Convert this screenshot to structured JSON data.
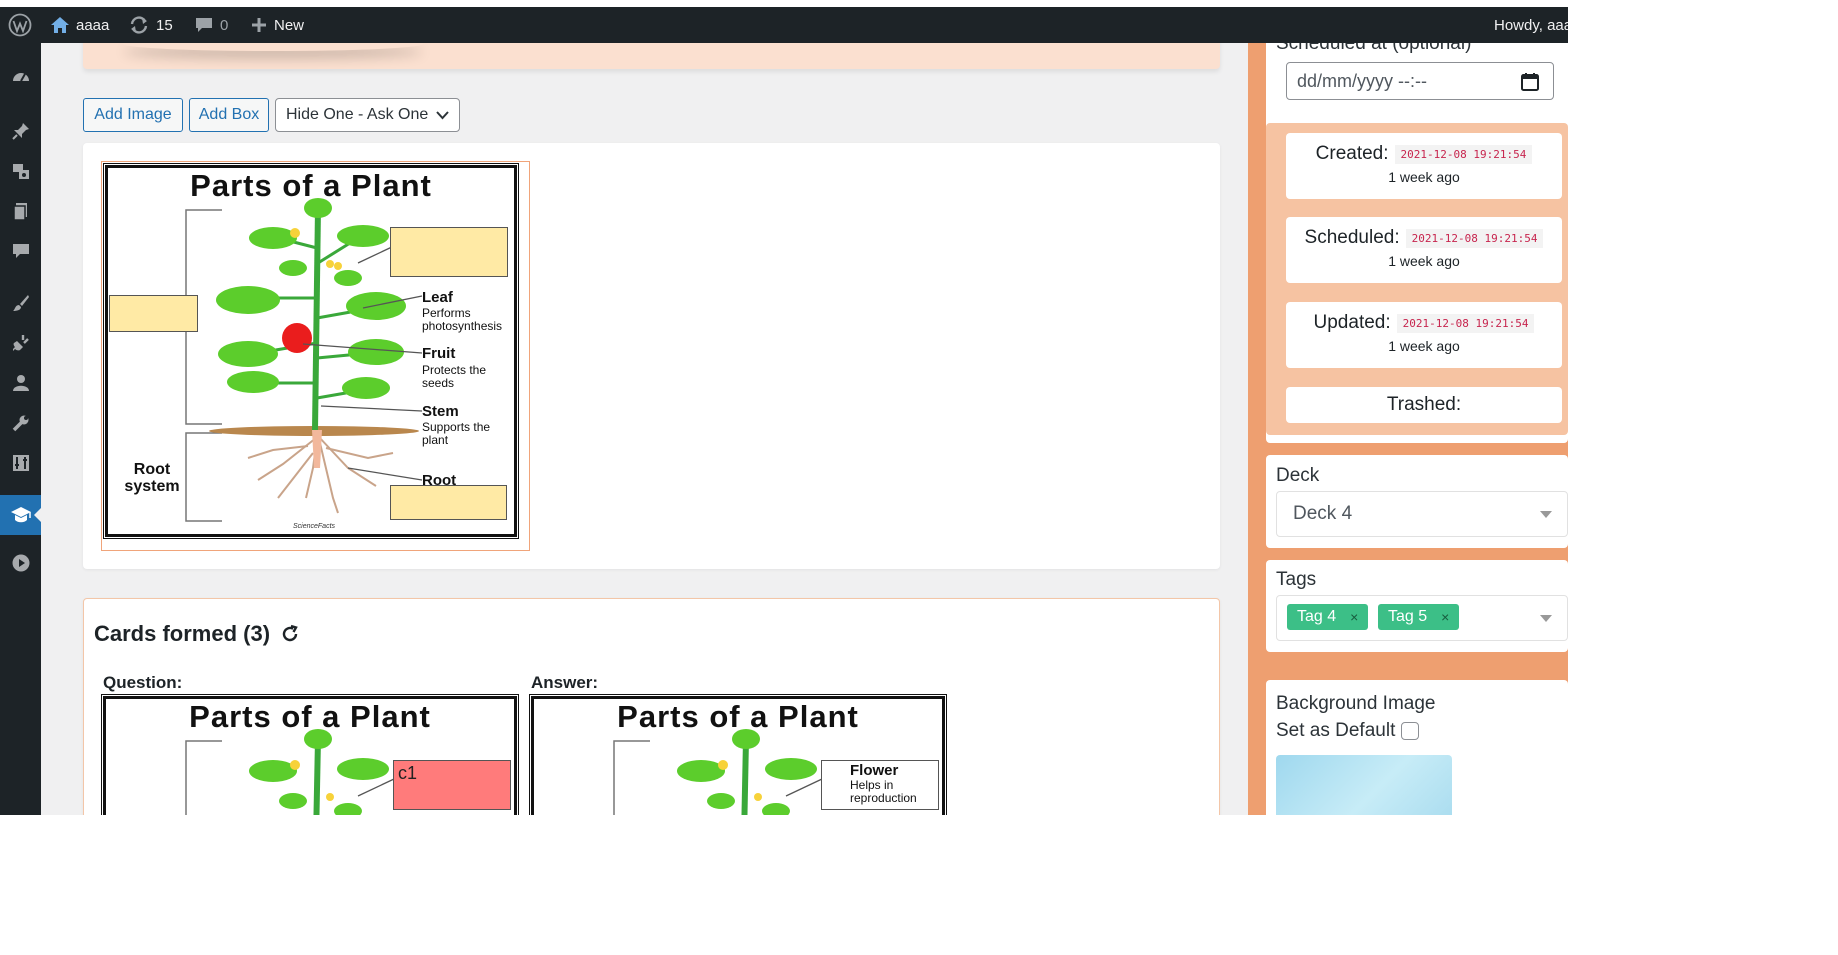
{
  "adminbar": {
    "site_name": "aaaa",
    "updates_count": "15",
    "comments_count": "0",
    "new_label": "New",
    "howdy": "Howdy, aaa"
  },
  "toolbar": {
    "add_image": "Add Image",
    "add_box": "Add Box",
    "mode_selected": "Hide One - Ask One"
  },
  "diagram": {
    "title": "Parts of a Plant",
    "leaf": "Leaf",
    "leaf_desc": "Performs photosynthesis",
    "fruit": "Fruit",
    "fruit_desc": "Protects the seeds",
    "stem": "Stem",
    "stem_desc": "Supports the plant",
    "root": "Root",
    "root_system": "Root system",
    "credit": "ScienceFacts"
  },
  "cards": {
    "heading": "Cards formed (3)",
    "question_label": "Question:",
    "answer_label": "Answer:",
    "question_box_text": "c1",
    "answer_flower": "Flower",
    "answer_flower_desc": "Helps in reproduction"
  },
  "sidebar": {
    "scheduled_at_label": "Scheduled at (optional)",
    "datetime_placeholder": "dd/mm/yyyy --:--",
    "created_label": "Created:",
    "created_ts": "2021-12-08 19:21:54",
    "created_ago": "1 week ago",
    "scheduled_label": "Scheduled:",
    "scheduled_ts": "2021-12-08 19:21:54",
    "scheduled_ago": "1 week ago",
    "updated_label": "Updated:",
    "updated_ts": "2021-12-08 19:21:54",
    "updated_ago": "1 week ago",
    "trashed_label": "Trashed:",
    "deck_label": "Deck",
    "deck_value": "Deck 4",
    "tags_label": "Tags",
    "tags": [
      "Tag 4",
      "Tag 5"
    ],
    "tag_remove": "×",
    "bg_image_label": "Background Image",
    "set_default_label": "Set as Default"
  },
  "colors": {
    "admin_bg": "#1d2327",
    "wp_blue": "#2271b1",
    "sidebar_orange": "#ee9f70",
    "tag_green": "#3cbf87",
    "occlusion_yellow": "#ffeaa5",
    "question_red": "#ff7b7b"
  }
}
